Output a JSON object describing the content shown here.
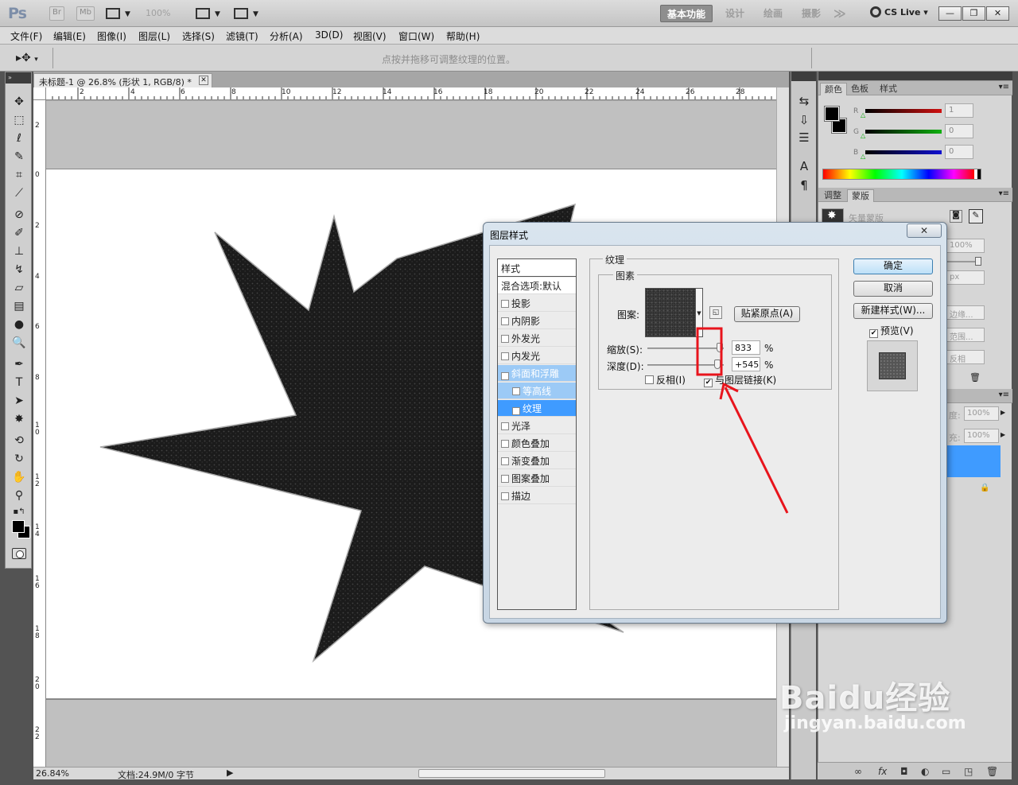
{
  "appbar": {
    "logo": "Ps",
    "br": "Br",
    "mb": "Mb",
    "zoom": "100%",
    "workspaces": [
      "基本功能",
      "设计",
      "绘画",
      "摄影"
    ],
    "more": "≫",
    "cslive": "CS Live",
    "win": [
      "—",
      "❐",
      "✕"
    ]
  },
  "menu": [
    "文件(F)",
    "编辑(E)",
    "图像(I)",
    "图层(L)",
    "选择(S)",
    "滤镜(T)",
    "分析(A)",
    "3D(D)",
    "视图(V)",
    "窗口(W)",
    "帮助(H)"
  ],
  "options": {
    "tool_icon": "▸✥",
    "dropdown": "▾",
    "hint": "点按并拖移可调整纹理的位置。"
  },
  "doc": {
    "tab_title": "未标题-1 @ 26.8% (形状 1, RGB/8) *",
    "close": "✕",
    "ruler_h": [
      "2",
      "4",
      "6",
      "8",
      "10",
      "12",
      "14",
      "16",
      "18",
      "20",
      "22",
      "24",
      "26",
      "28"
    ],
    "ruler_v": [
      "2",
      "0",
      "2",
      "4",
      "6",
      "8",
      "10",
      "12",
      "14",
      "16",
      "18",
      "20",
      "22"
    ],
    "status_zoom": "26.84%",
    "status_doc": "文档:24.9M/0 字节"
  },
  "colors": {
    "starburst_fill": "#1b1b1b",
    "selection": "#3f9bff",
    "annotation": "#e8141c"
  },
  "color_panel": {
    "tabs": [
      "颜色",
      "色板",
      "样式"
    ],
    "channels": [
      {
        "label": "R",
        "value": "1",
        "color": "#d01010"
      },
      {
        "label": "G",
        "value": "0",
        "color": "#10b010"
      },
      {
        "label": "B",
        "value": "0",
        "color": "#1010d0"
      }
    ]
  },
  "adjust_panel": {
    "tabs": [
      "调整",
      "蒙版"
    ],
    "mask_type": "矢量蒙版",
    "density": "100%",
    "feather": "px",
    "edge": "边缘...",
    "range": "范围...",
    "invert": "反相"
  },
  "layers_panel": {
    "opacity_label": "度:",
    "opacity": "100%",
    "fill_label": "充:",
    "fill": "100%",
    "bottom_icons": [
      "∞",
      "fx",
      "◘",
      "◐",
      "▭",
      "◳",
      "🗑"
    ]
  },
  "dialog": {
    "title": "图层样式",
    "close": "✕",
    "list_header": "样式",
    "blend": "混合选项:默认",
    "items": [
      {
        "label": "投影",
        "checked": false
      },
      {
        "label": "内阴影",
        "checked": false
      },
      {
        "label": "外发光",
        "checked": false
      },
      {
        "label": "内发光",
        "checked": false
      },
      {
        "label": "斜面和浮雕",
        "checked": true
      },
      {
        "label": "等高线",
        "checked": false
      },
      {
        "label": "纹理",
        "checked": true
      },
      {
        "label": "光泽",
        "checked": false
      },
      {
        "label": "颜色叠加",
        "checked": false
      },
      {
        "label": "渐变叠加",
        "checked": false
      },
      {
        "label": "图案叠加",
        "checked": false
      },
      {
        "label": "描边",
        "checked": false
      }
    ],
    "texture_title": "纹理",
    "elements_title": "图素",
    "pattern_label": "图案:",
    "snap_button": "贴紧原点(A)",
    "scale_label": "缩放(S):",
    "scale_value": "833",
    "scale_fraction": 0.95,
    "depth_label": "深度(D):",
    "depth_value": "+545",
    "depth_fraction": 0.92,
    "percent": "%",
    "invert_label": "反相(I)",
    "link_label": "与图层链接(K)",
    "ok": "确定",
    "cancel": "取消",
    "new_style": "新建样式(W)...",
    "preview": "预览(V)"
  },
  "watermark": {
    "brand": "Baidu经验",
    "url": "jingyan.baidu.com"
  }
}
